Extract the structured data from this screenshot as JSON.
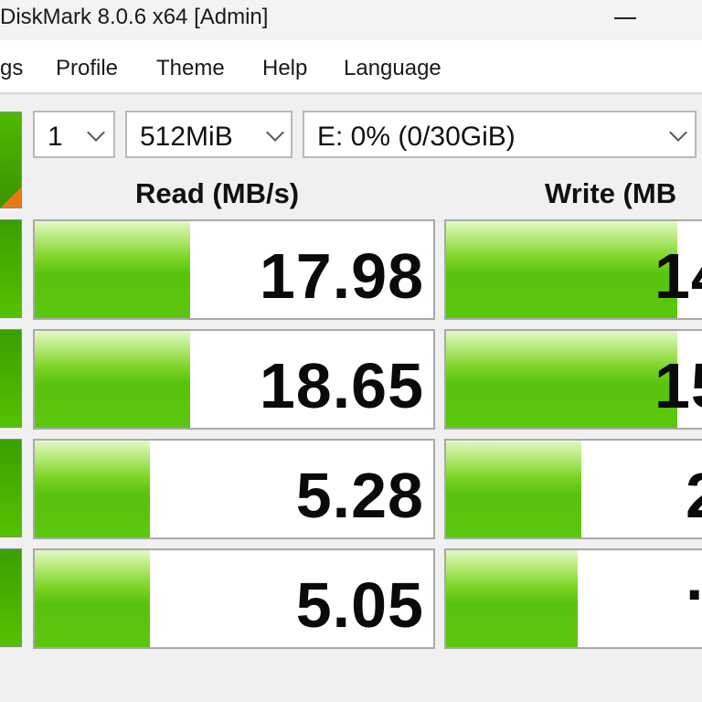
{
  "window": {
    "title": "DiskMark 8.0.6 x64 [Admin]"
  },
  "menu": {
    "items": [
      "gs",
      "Profile",
      "Theme",
      "Help",
      "Language"
    ]
  },
  "controls": {
    "count": "1",
    "size": "512MiB",
    "drive": "E: 0% (0/30GiB)"
  },
  "headers": {
    "read": "Read (MB/s)",
    "write": "Write (MB"
  },
  "results": {
    "read": [
      "17.98",
      "18.65",
      "5.28",
      "5.05"
    ],
    "write": [
      "14",
      "15",
      "2",
      "..."
    ],
    "read_bar_fraction": [
      0.39,
      0.39,
      0.29,
      0.29
    ],
    "write_bar_fraction": [
      0.58,
      0.58,
      0.34,
      0.33
    ]
  },
  "colors": {
    "bar_green": "#5ac70e",
    "all_button_corner": "#e87a14"
  },
  "icons": {
    "combo_arrow": "chevron-down-icon",
    "minimize": "minimize-icon"
  }
}
